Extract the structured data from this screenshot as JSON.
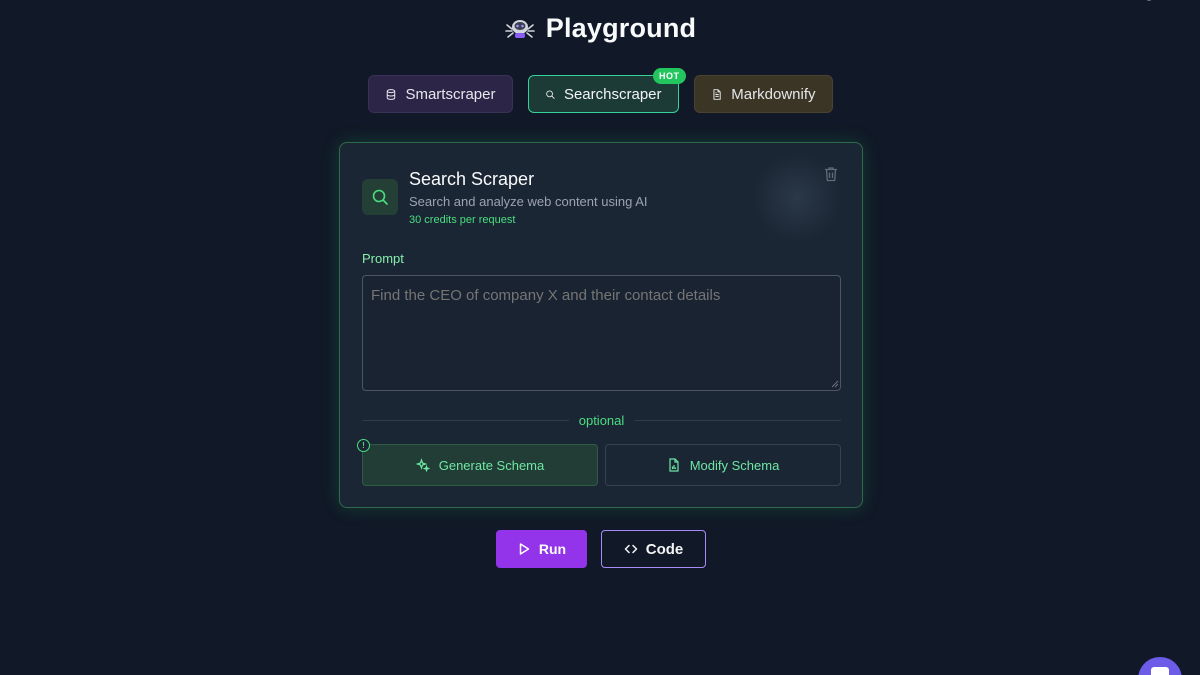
{
  "header": {
    "title": "Playground",
    "logo_icon": "spider-robot-icon"
  },
  "tabs": [
    {
      "label": "Smartscraper",
      "icon": "database-icon"
    },
    {
      "label": "Searchscraper",
      "icon": "search-icon",
      "badge": "HOT",
      "active": true
    },
    {
      "label": "Markdownify",
      "icon": "document-icon"
    }
  ],
  "card": {
    "title": "Search Scraper",
    "subtitle": "Search and analyze web content using AI",
    "credits": "30 credits per request",
    "prompt_label": "Prompt",
    "prompt_placeholder": "Find the CEO of company X and their contact details",
    "prompt_value": "",
    "divider_label": "optional",
    "generate_label": "Generate Schema",
    "modify_label": "Modify Schema"
  },
  "actions": {
    "run_label": "Run",
    "code_label": "Code"
  },
  "colors": {
    "accent_green": "#4ade80",
    "accent_purple": "#9333ea",
    "background": "#111827"
  }
}
